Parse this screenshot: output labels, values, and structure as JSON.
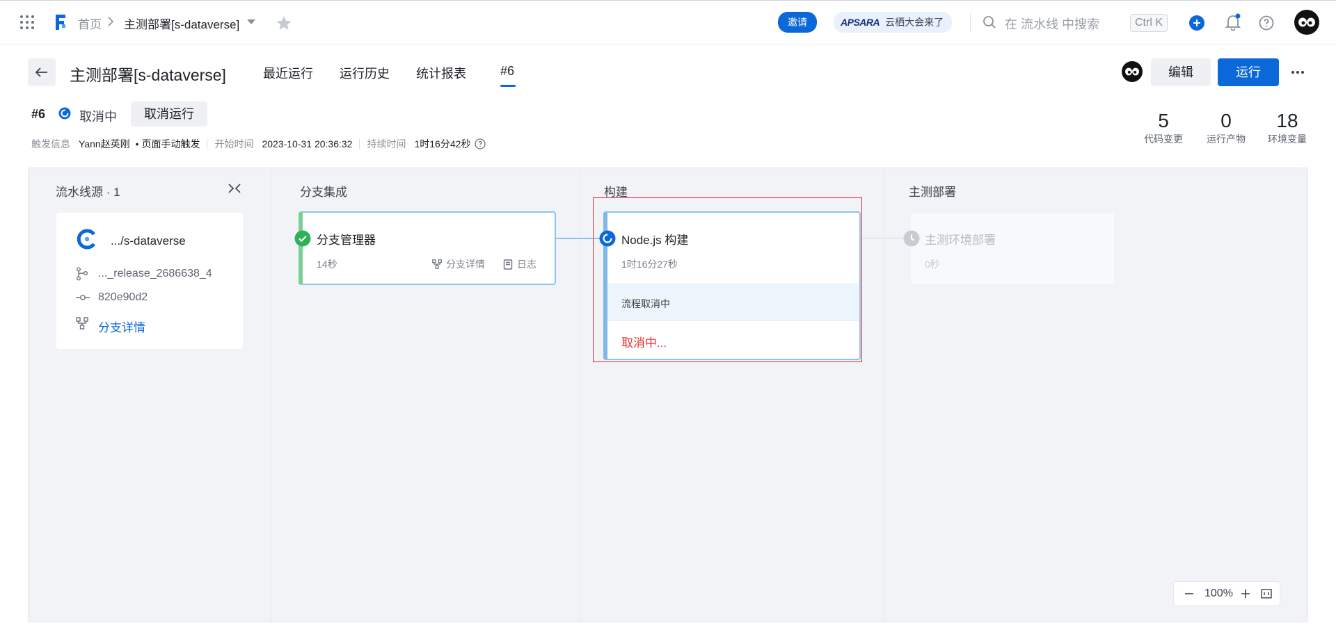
{
  "topbar": {
    "breadcrumb_home": "首页",
    "breadcrumb_current": "主测部署[s-dataverse]",
    "invite_label": "邀请",
    "apsara_brand": "APSARA",
    "apsara_text": "云栖大会来了",
    "search_placeholder": "在 流水线 中搜索",
    "shortcut": "Ctrl K"
  },
  "header": {
    "title": "主测部署[s-dataverse]",
    "tabs": [
      "最近运行",
      "运行历史",
      "统计报表",
      "#6"
    ],
    "edit_label": "编辑",
    "run_label": "运行"
  },
  "run": {
    "number": "#6",
    "status": "取消中",
    "cancel_label": "取消运行",
    "trigger_label": "触发信息",
    "trigger_user": "Yann赵英刚",
    "trigger_method": "• 页面手动触发",
    "start_label": "开始时间",
    "start_time": "2023-10-31 20:36:32",
    "duration_label": "持续时间",
    "duration": "1时16分42秒"
  },
  "stats": [
    {
      "value": "5",
      "label": "代码变更"
    },
    {
      "value": "0",
      "label": "运行产物"
    },
    {
      "value": "18",
      "label": "环境变量"
    }
  ],
  "source": {
    "title": "流水线源 · 1",
    "repo": ".../s-dataverse",
    "branch": "..._release_2686638_4",
    "commit": "820e90d2",
    "details_link": "分支详情"
  },
  "stages": [
    {
      "title": "分支集成",
      "job": {
        "name": "分支管理器",
        "time": "14秒",
        "details": "分支详情",
        "log": "日志"
      }
    },
    {
      "title": "构建",
      "job": {
        "name": "Node.js 构建",
        "time": "1时16分27秒",
        "status_note": "流程取消中",
        "action": "取消中..."
      }
    },
    {
      "title": "主测部署",
      "job": {
        "name": "主测环境部署",
        "time": "0秒"
      }
    }
  ],
  "zoom": {
    "level": "100%"
  },
  "colors": {
    "accent": "#0b68d8",
    "success": "#2fb15c",
    "cancel_red": "#e6312e",
    "highlight_box": "#e0282e"
  }
}
